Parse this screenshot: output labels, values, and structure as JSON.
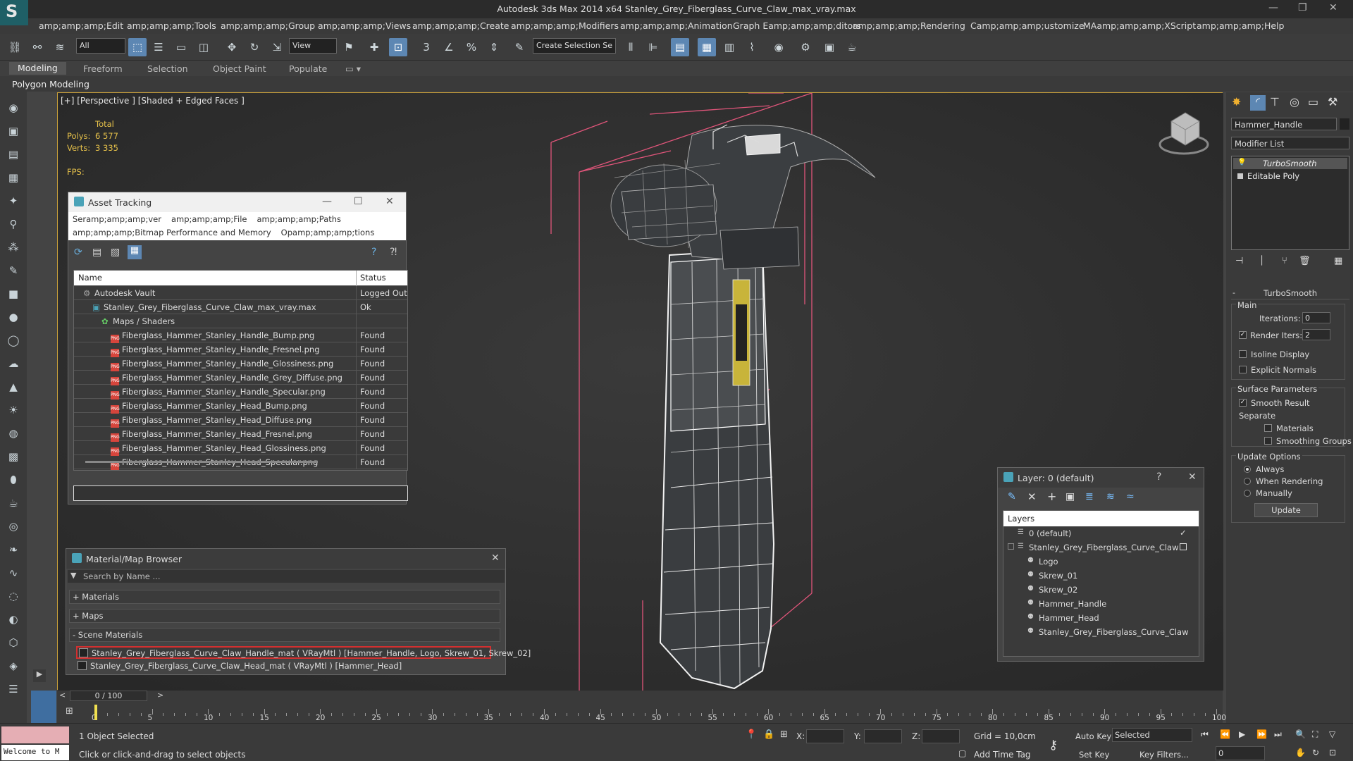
{
  "window": {
    "title": "Autodesk 3ds Max  2014 x64      Stanley_Grey_Fiberglass_Curve_Claw_max_vray.max",
    "logo_letter": "S"
  },
  "menu": [
    "amp;amp;amp;Edit",
    "amp;amp;amp;Tools",
    "amp;amp;amp;Group",
    "amp;amp;amp;Views",
    "amp;amp;amp;Create",
    "amp;amp;amp;Modifiers",
    "amp;amp;amp;Animation",
    "Graph Eamp;amp;amp;ditors",
    "amp;amp;amp;Rendering",
    "Camp;amp;amp;ustomize",
    "MAamp;amp;amp;XScript",
    "amp;amp;amp;Help"
  ],
  "toolbar": {
    "filter_value": "All",
    "refcoord_value": "View",
    "selection_set_placeholder": "Create Selection Se"
  },
  "ribbon": {
    "tabs": [
      "Modeling",
      "Freeform",
      "Selection",
      "Object Paint",
      "Populate"
    ],
    "active": "Modeling",
    "subtitle": "Polygon Modeling"
  },
  "viewport": {
    "label": "[+] [Perspective ] [Shaded + Edged Faces ]",
    "stats": {
      "total_label": "Total",
      "polys_label": "Polys:",
      "polys_value": "6 577",
      "verts_label": "Verts:",
      "verts_value": "3 335",
      "fps_label": "FPS:"
    }
  },
  "asset_tracking": {
    "title": "Asset Tracking",
    "menu1": [
      "Seramp;amp;amp;ver",
      "amp;amp;amp;File",
      "amp;amp;amp;Paths"
    ],
    "menu2": [
      "amp;amp;amp;Bitmap Performance and Memory",
      "Opamp;amp;amp;tions"
    ],
    "col_name": "Name",
    "col_status": "Status",
    "rows": [
      {
        "name": "Autodesk Vault",
        "status": "Logged Out",
        "indent": 1,
        "icon": "vault"
      },
      {
        "name": "Stanley_Grey_Fiberglass_Curve_Claw_max_vray.max",
        "status": "Ok",
        "indent": 2,
        "icon": "max"
      },
      {
        "name": "Maps / Shaders",
        "status": "",
        "indent": 3,
        "icon": "maps"
      },
      {
        "name": "Fiberglass_Hammer_Stanley_Handle_Bump.png",
        "status": "Found",
        "indent": 4,
        "icon": "png"
      },
      {
        "name": "Fiberglass_Hammer_Stanley_Handle_Fresnel.png",
        "status": "Found",
        "indent": 4,
        "icon": "png"
      },
      {
        "name": "Fiberglass_Hammer_Stanley_Handle_Glossiness.png",
        "status": "Found",
        "indent": 4,
        "icon": "png"
      },
      {
        "name": "Fiberglass_Hammer_Stanley_Handle_Grey_Diffuse.png",
        "status": "Found",
        "indent": 4,
        "icon": "png"
      },
      {
        "name": "Fiberglass_Hammer_Stanley_Handle_Specular.png",
        "status": "Found",
        "indent": 4,
        "icon": "png"
      },
      {
        "name": "Fiberglass_Hammer_Stanley_Head_Bump.png",
        "status": "Found",
        "indent": 4,
        "icon": "png"
      },
      {
        "name": "Fiberglass_Hammer_Stanley_Head_Diffuse.png",
        "status": "Found",
        "indent": 4,
        "icon": "png"
      },
      {
        "name": "Fiberglass_Hammer_Stanley_Head_Fresnel.png",
        "status": "Found",
        "indent": 4,
        "icon": "png"
      },
      {
        "name": "Fiberglass_Hammer_Stanley_Head_Glossiness.png",
        "status": "Found",
        "indent": 4,
        "icon": "png"
      },
      {
        "name": "Fiberglass_Hammer_Stanley_Head_Specular.png",
        "status": "Found",
        "indent": 4,
        "icon": "png"
      }
    ]
  },
  "material_browser": {
    "title": "Material/Map Browser",
    "search_placeholder": "Search by Name ...",
    "groups": [
      "+ Materials",
      "+ Maps",
      "- Scene Materials"
    ],
    "materials": [
      "Stanley_Grey_Fiberglass_Curve_Claw_Handle_mat  ( VRayMtl ) [Hammer_Handle, Logo, Skrew_01, Skrew_02]",
      "Stanley_Grey_Fiberglass_Curve_Claw_Head_mat  ( VRayMtl ) [Hammer_Head]"
    ]
  },
  "layers": {
    "title": "Layer: 0 (default)",
    "help": "?",
    "header": "Layers",
    "items": [
      {
        "name": "0 (default)",
        "level": 0
      },
      {
        "name": "Stanley_Grey_Fiberglass_Curve_Claw",
        "level": 0
      },
      {
        "name": "Logo",
        "level": 1
      },
      {
        "name": "Skrew_01",
        "level": 1
      },
      {
        "name": "Skrew_02",
        "level": 1
      },
      {
        "name": "Hammer_Handle",
        "level": 1
      },
      {
        "name": "Hammer_Head",
        "level": 1
      },
      {
        "name": "Stanley_Grey_Fiberglass_Curve_Claw",
        "level": 1
      }
    ]
  },
  "command_panel": {
    "object_name": "Hammer_Handle",
    "modifier_list": "Modifier List",
    "stack": [
      "TurboSmooth",
      "Editable Poly"
    ],
    "rollout_title": "TurboSmooth",
    "main_label": "Main",
    "iterations_label": "Iterations:",
    "iterations_value": "0",
    "render_iters_label": "Render Iters:",
    "render_iters_value": "2",
    "isoline_label": "Isoline Display",
    "explicit_normals_label": "Explicit Normals",
    "surface_params_label": "Surface Parameters",
    "smooth_result_label": "Smooth Result",
    "separate_label": "Separate",
    "materials_label": "Materials",
    "smoothing_groups_label": "Smoothing Groups",
    "update_options_label": "Update Options",
    "always_label": "Always",
    "when_rendering_label": "When Rendering",
    "manually_label": "Manually",
    "update_button": "Update"
  },
  "timeline": {
    "frame": "0 / 100",
    "ticks": [
      "0",
      "5",
      "10",
      "15",
      "20",
      "25",
      "30",
      "35",
      "40",
      "45",
      "50",
      "55",
      "60",
      "65",
      "70",
      "75",
      "80",
      "85",
      "90",
      "95",
      "100"
    ]
  },
  "status": {
    "maxscript": "Welcome to M",
    "selected": "1 Object Selected",
    "prompt": "Click or click-and-drag to select objects",
    "x_label": "X:",
    "y_label": "Y:",
    "z_label": "Z:",
    "grid": "Grid = 10,0cm",
    "add_time_tag": "Add Time Tag",
    "auto_key": "Auto Key",
    "set_key": "Set Key",
    "selected_dropdown": "Selected",
    "key_filters": "Key Filters...",
    "frame_value": "0"
  },
  "colors": {
    "accent": "#5d87b3",
    "viewport_border": "#c9a03a",
    "stat_text": "#e6c14a",
    "hammer_head": "#3a3d40"
  }
}
